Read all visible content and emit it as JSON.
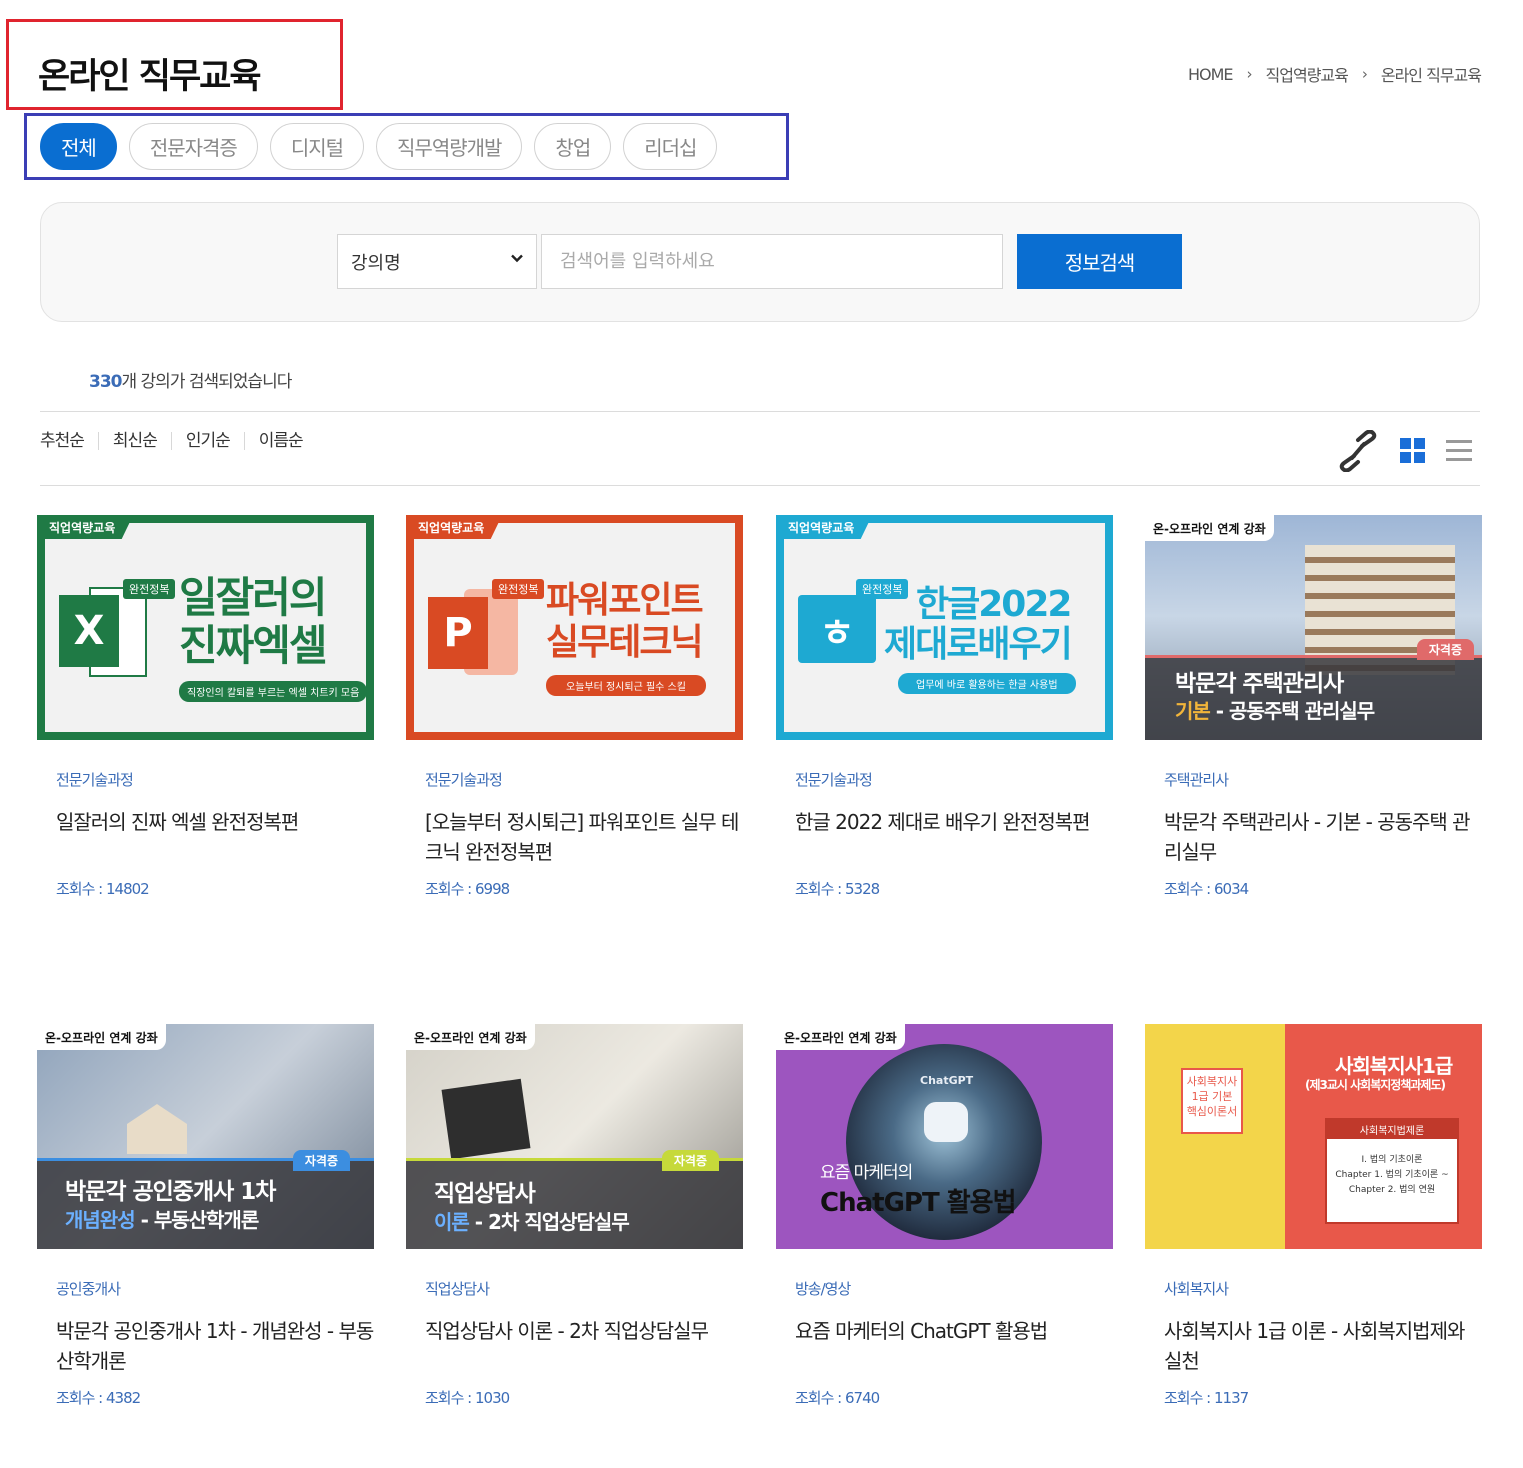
{
  "page": {
    "title": "온라인 직무교육",
    "breadcrumb": [
      "HOME",
      "직업역량교육",
      "온라인 직무교육"
    ]
  },
  "tabs": [
    {
      "label": "전체",
      "active": true
    },
    {
      "label": "전문자격증",
      "active": false
    },
    {
      "label": "디지털",
      "active": false
    },
    {
      "label": "직무역량개발",
      "active": false
    },
    {
      "label": "창업",
      "active": false
    },
    {
      "label": "리더십",
      "active": false
    }
  ],
  "search": {
    "select_value": "강의명",
    "placeholder": "검색어를 입력하세요",
    "button_label": "정보검색"
  },
  "results": {
    "count": "330",
    "suffix": "개 강의가 검색되었습니다"
  },
  "sort_options": [
    "추천순",
    "최신순",
    "인기순",
    "이름순"
  ],
  "view_icons": [
    "link-icon",
    "grid-view-icon",
    "list-view-icon"
  ],
  "colors": {
    "accent": "#0a6ed1",
    "category_text": "#3b6cb7",
    "highlight_red_box": "#e0242e",
    "highlight_blue_box": "#3b3eb5"
  },
  "courses": [
    {
      "category": "전문기술과정",
      "title": "일잘러의 진짜 엑셀 완전정복편",
      "views": "조회수 : 14802",
      "thumb": {
        "badge": "직업역량교육",
        "tag": "완전정복",
        "line1": "일잘러의",
        "line2": "진짜엑셀",
        "sub": "직장인의 칼퇴를 부르는 엑셀 치트키 모음",
        "icon": "excel-icon",
        "icon_letter": "X",
        "color": "#1f7a45"
      }
    },
    {
      "category": "전문기술과정",
      "title": "[오늘부터 정시퇴근] 파워포인트 실무 테크닉 완전정복편",
      "views": "조회수 : 6998",
      "thumb": {
        "badge": "직업역량교육",
        "tag": "완전정복",
        "line1": "파워포인트",
        "line2": "실무테크닉",
        "sub": "오늘부터 정시퇴근 필수 스킬",
        "icon": "powerpoint-icon",
        "icon_letter": "P",
        "color": "#d94a23"
      }
    },
    {
      "category": "전문기술과정",
      "title": "한글 2022 제대로 배우기 완전정복편",
      "views": "조회수 : 5328",
      "thumb": {
        "badge": "직업역량교육",
        "tag": "완전정복",
        "line1": "한글2022",
        "line2": "제대로배우기",
        "sub": "업무에 바로 활용하는 한글 사용법",
        "icon": "hwp-icon",
        "icon_letter": "ㅎ",
        "color": "#1ea9d2"
      }
    },
    {
      "category": "주택관리사",
      "title": "박문각 주택관리사 - 기본 - 공동주택 관리실무",
      "views": "조회수 : 6034",
      "thumb": {
        "badge": "온-오프라인 연계 강좌",
        "tag": "자격증",
        "line1": "박문각 주택관리사",
        "line2_hl": "기본",
        "line2": " - 공동주택 관리실무"
      }
    },
    {
      "category": "공인중개사",
      "title": "박문각 공인중개사 1차 - 개념완성 - 부동산학개론",
      "views": "조회수 : 4382",
      "thumb": {
        "badge": "온-오프라인 연계 강좌",
        "tag": "자격증",
        "line1": "박문각 공인중개사 1차",
        "line2_hl": "개념완성",
        "line2": " - 부동산학개론"
      }
    },
    {
      "category": "직업상담사",
      "title": "직업상담사 이론 - 2차 직업상담실무",
      "views": "조회수 : 1030",
      "thumb": {
        "badge": "온-오프라인 연계 강좌",
        "tag": "자격증",
        "line1": "직업상담사",
        "line2_hl": "이론",
        "line2": " - 2차 직업상담실무"
      }
    },
    {
      "category": "방송/영상",
      "title": "요즘 마케터의 ChatGPT 활용법",
      "views": "조회수 : 6740",
      "thumb": {
        "badge": "온-오프라인 연계 강좌",
        "small": "요즘 마케터의",
        "big": "ChatGPT 활용법",
        "logo": "ChatGPT"
      }
    },
    {
      "category": "사회복지사",
      "title": "사회복지사 1급 이론 - 사회복지법제와 실천",
      "views": "조회수 : 1137",
      "thumb": {
        "line1": "사회복지사1급",
        "line2": "(제3교시 사회복지정책과제도)",
        "box_title": "사회복지법제론",
        "box_lines": [
          "Ⅰ. 법의 기초이론",
          "Chapter 1. 법의 기초이론 ~",
          "Chapter 2. 법의 연원"
        ],
        "book": [
          "사회복지사",
          "1급 기본",
          "핵심이론서"
        ]
      }
    }
  ]
}
